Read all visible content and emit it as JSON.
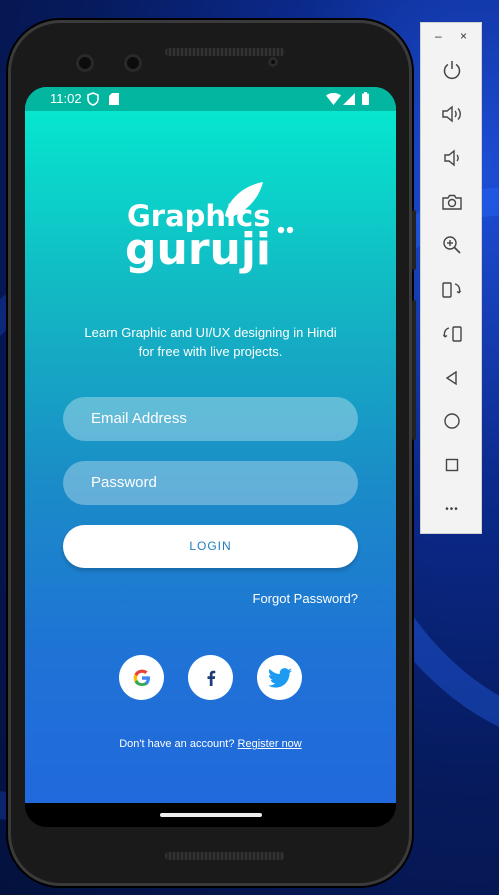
{
  "status_bar": {
    "time": "11:02"
  },
  "app": {
    "logo_text_top": "Graphics",
    "logo_text_bottom": "guruji",
    "tagline_line1": "Learn Graphic and UI/UX designing in Hindi",
    "tagline_line2": "for free with live projects.",
    "email_placeholder": "Email Address",
    "password_placeholder": "Password",
    "login_label": "LOGIN",
    "forgot_label": "Forgot Password?",
    "social": [
      {
        "name": "google-icon",
        "glyph": "G"
      },
      {
        "name": "facebook-icon",
        "glyph": "f"
      },
      {
        "name": "twitter-icon",
        "glyph": ""
      }
    ],
    "signup_prefix": "Don't have an account?",
    "signup_link": "Register now"
  },
  "emulator_toolbar": {
    "minimize": "–",
    "close": "×",
    "buttons": [
      "power-icon",
      "volume-up-icon",
      "volume-down-icon",
      "camera-icon",
      "zoom-in-icon",
      "rotate-left-icon",
      "rotate-right-icon",
      "back-icon",
      "home-icon",
      "overview-icon",
      "more-icon"
    ],
    "more_label": "•••"
  },
  "colors": {
    "status_bar": "#02b6a0",
    "gradient_top": "#05ecd0",
    "gradient_bottom": "#2169dd",
    "login_text": "#1f7fbf",
    "twitter": "#1d9bf0",
    "facebook": "#1d3a7a"
  }
}
